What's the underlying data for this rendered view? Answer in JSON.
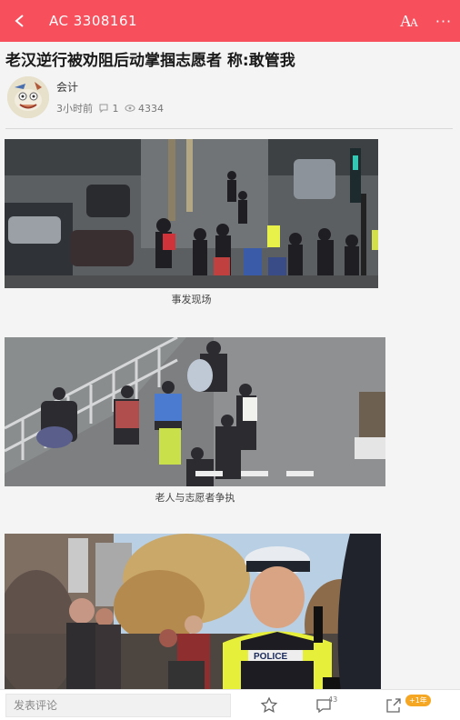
{
  "header": {
    "title": "AC 3308161",
    "font_label": "A",
    "font_label_small": "A",
    "more_label": "···",
    "background": "#f74f5c"
  },
  "article": {
    "title": "老汉逆行被劝阻后动掌掴志愿者 称:敢管我",
    "author": "会计",
    "time": "3小时前",
    "comments": "1",
    "views": "4334"
  },
  "figures": [
    {
      "caption": "事发现场"
    },
    {
      "caption": "老人与志愿者争执"
    },
    {
      "caption": ""
    }
  ],
  "photo_texts": {
    "police_vest": "POLICE"
  },
  "bottom": {
    "comment_placeholder": "发表评论",
    "comment_count": "43",
    "share_badge": "+1年"
  }
}
